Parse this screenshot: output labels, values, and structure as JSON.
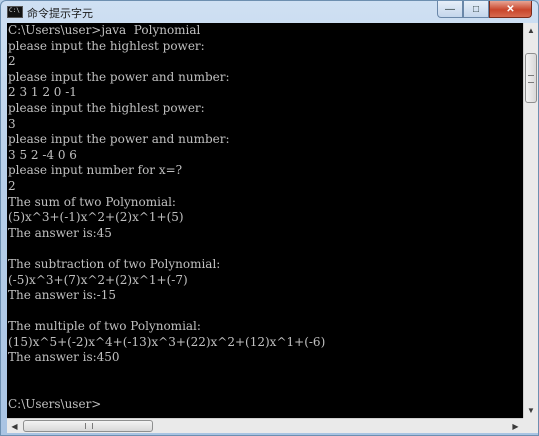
{
  "window": {
    "title": "命令提示字元",
    "icon": "cmd-icon",
    "icon_text": "C:\\",
    "controls": {
      "minimize": "—",
      "maximize": "□",
      "close": "✕"
    }
  },
  "console": {
    "lines": [
      "C:\\Users\\user>java  Polynomial",
      "please input the highlest power:",
      "2",
      "please input the power and number:",
      "2 3 1 2 0 -1",
      "please input the highlest power:",
      "3",
      "please input the power and number:",
      "3 5 2 -4 0 6",
      "please input number for x=?",
      "2",
      "The sum of two Polynomial:",
      "(5)x^3+(-1)x^2+(2)x^1+(5)",
      "The answer is:45",
      "",
      "The subtraction of two Polynomial:",
      "(-5)x^3+(7)x^2+(2)x^1+(-7)",
      "The answer is:-15",
      "",
      "The multiple of two Polynomial:",
      "(15)x^5+(-2)x^4+(-13)x^3+(22)x^2+(12)x^1+(-6)",
      "The answer is:450",
      "",
      "",
      "C:\\Users\\user>"
    ]
  },
  "scrollbars": {
    "up": "▲",
    "down": "▼",
    "left": "◀",
    "right": "▶"
  }
}
